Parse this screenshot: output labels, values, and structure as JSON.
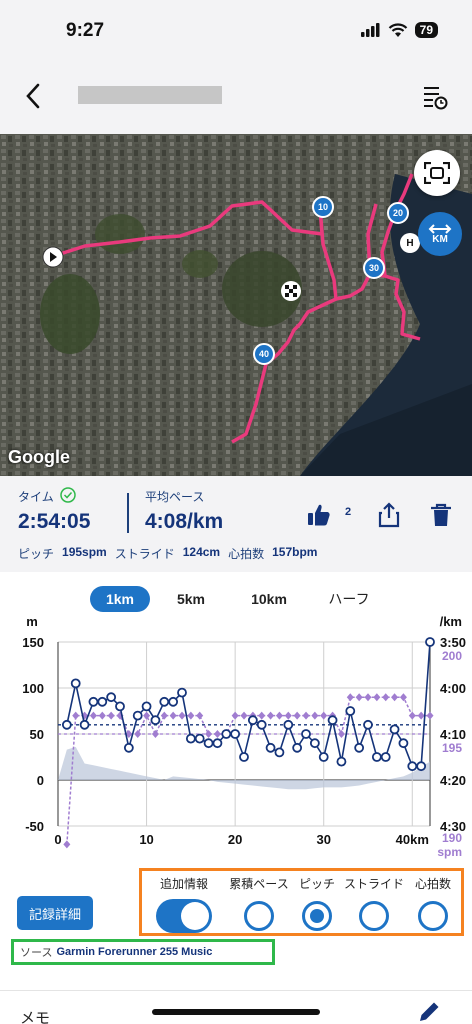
{
  "status_bar": {
    "time": "9:27",
    "battery": "79"
  },
  "nav": {
    "back_icon": "chevron-left-icon",
    "list_icon": "list-settings-icon"
  },
  "map": {
    "attribution": "Google",
    "markers": [
      "10",
      "20",
      "30",
      "40"
    ],
    "home_marker": "H",
    "km_toggle": "KM",
    "fullscreen_icon": "fullscreen-icon",
    "route_color": "#e93a7d"
  },
  "summary": {
    "time_label": "タイム",
    "time_value": "2:54:05",
    "pace_label": "平均ペース",
    "pace_value": "4:08/km",
    "likes": "2",
    "pitch_label": "ピッチ",
    "pitch_value": "195spm",
    "stride_label": "ストライド",
    "stride_value": "124cm",
    "hr_label": "心拍数",
    "hr_value": "157bpm"
  },
  "tabs": [
    "1km",
    "5km",
    "10km",
    "ハーフ"
  ],
  "chart_data": {
    "type": "line",
    "left_axis_unit": "m",
    "right_axis_unit": "/km",
    "left_ticks": [
      "150",
      "100",
      "50",
      "0",
      "-50"
    ],
    "right_ticks": [
      "3:50",
      "4:00",
      "4:10",
      "4:20",
      "4:30"
    ],
    "x_ticks": [
      "0",
      "10",
      "20",
      "30",
      "40km"
    ],
    "pitch_labels": [
      "200",
      "195",
      "190 spm"
    ],
    "ylim": [
      -50,
      150
    ],
    "pace_yrange_sec_per_km": [
      230,
      270
    ],
    "pitch_yrange": [
      190,
      200
    ],
    "x": [
      1,
      2,
      3,
      4,
      5,
      6,
      7,
      8,
      9,
      10,
      11,
      12,
      13,
      14,
      15,
      16,
      17,
      18,
      19,
      20,
      21,
      22,
      23,
      24,
      25,
      26,
      27,
      28,
      29,
      30,
      31,
      32,
      33,
      34,
      35,
      36,
      37,
      38,
      39,
      40,
      41,
      42
    ],
    "series": [
      {
        "name": "",
        "color": "#15347a",
        "values": [
          248,
          239,
          248,
          243,
          243,
          242,
          244,
          253,
          246,
          244,
          247,
          243,
          243,
          241,
          251,
          251,
          252,
          252,
          250,
          250,
          255,
          247,
          248,
          253,
          254,
          248,
          253,
          250,
          252,
          255,
          247,
          256,
          245,
          253,
          248,
          255,
          255,
          249,
          252,
          257,
          257,
          230
        ],
        "mean": 248
      },
      {
        "name": "",
        "color": "#a07dd0",
        "values": [
          189,
          196,
          196,
          196,
          196,
          196,
          196,
          195,
          195,
          196,
          195,
          196,
          196,
          196,
          196,
          196,
          195,
          195,
          195,
          196,
          196,
          196,
          196,
          196,
          196,
          196,
          196,
          196,
          196,
          196,
          196,
          195,
          197,
          197,
          197,
          197,
          197,
          197,
          197,
          196,
          196,
          196
        ],
        "mean": 195
      },
      {
        "name": "",
        "color": "#b9c5d8",
        "values": [
          33,
          36,
          18,
          16,
          14,
          12,
          10,
          8,
          6,
          4,
          2,
          0,
          4,
          3,
          2,
          1,
          0,
          -2,
          -3,
          -4,
          -5,
          -6,
          -7,
          -8,
          -9,
          -10,
          -10,
          -10,
          -9,
          -8,
          -8,
          -8,
          -7,
          -6,
          -4,
          -2,
          0,
          2,
          4,
          8,
          14,
          20
        ]
      }
    ]
  },
  "info_options": {
    "extra_label": "追加情報",
    "options": [
      "累積ペース",
      "ピッチ",
      "ストライド",
      "心拍数"
    ],
    "selected": "ピッチ"
  },
  "detail_button": "記録詳細",
  "source": {
    "label": "ソース",
    "value": "Garmin Forerunner 255 Music"
  },
  "memo": {
    "label": "メモ",
    "edit_icon": "pencil-icon"
  }
}
